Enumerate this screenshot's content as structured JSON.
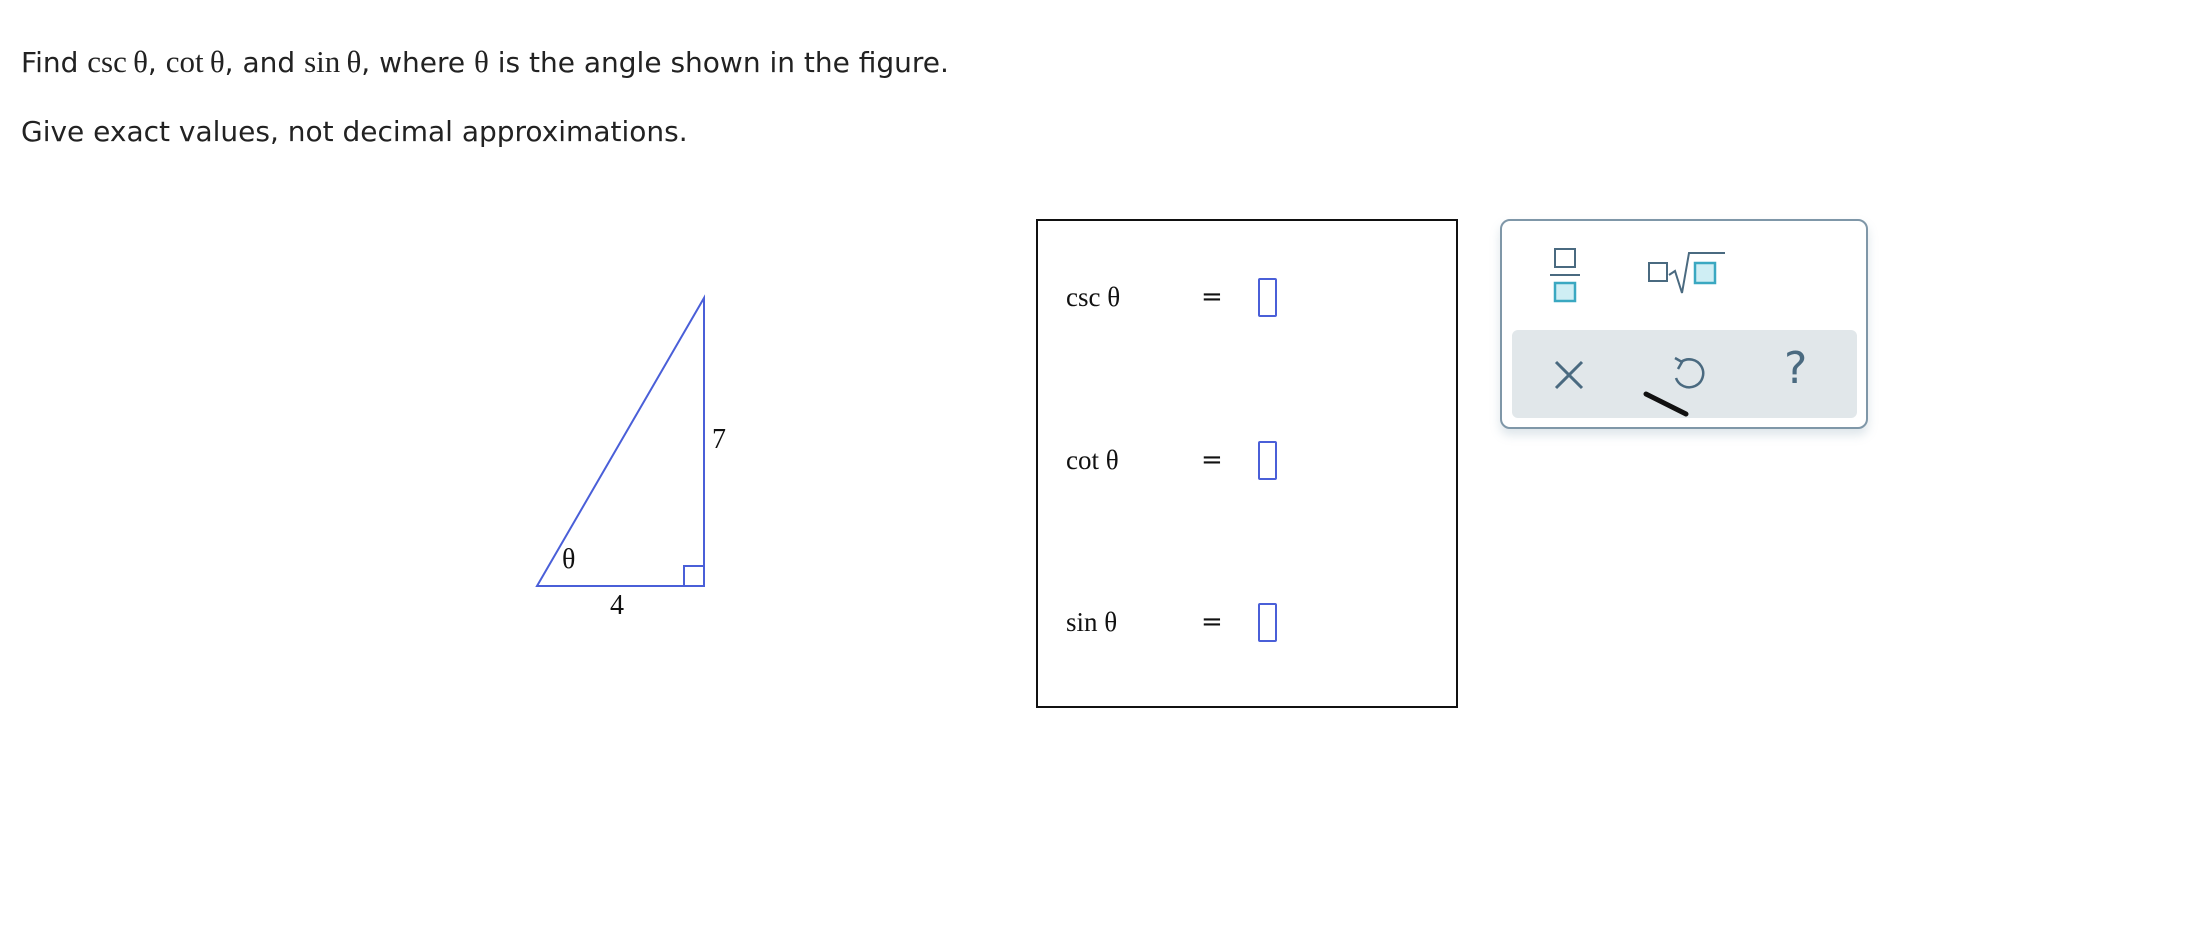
{
  "question": {
    "line1": {
      "t1": "Find ",
      "csc": "csc θ",
      "t2": ", ",
      "cot": "cot θ",
      "t3": ", and ",
      "sin": "sin θ",
      "t4": ", where ",
      "theta": "θ",
      "t5": " is the angle shown in the figure."
    },
    "line2": "Give exact values, not decimal approximations."
  },
  "figure": {
    "angle_label": "θ",
    "vertical_side": "7",
    "horizontal_side": "4",
    "stroke_color": "#4a5fd8"
  },
  "answers": {
    "rows": [
      {
        "label": "csc θ",
        "eq": "=",
        "value": ""
      },
      {
        "label": "cot θ",
        "eq": "=",
        "value": ""
      },
      {
        "label": "sin θ",
        "eq": "=",
        "value": ""
      }
    ]
  },
  "palette": {
    "fraction_icon": "fraction-icon",
    "nroot_icon": "nth-root-icon",
    "clear_icon": "close-icon",
    "undo_icon": "undo-icon",
    "help_label": "?",
    "accent_color": "#3aa8c1",
    "icon_color": "#4a6a80"
  }
}
